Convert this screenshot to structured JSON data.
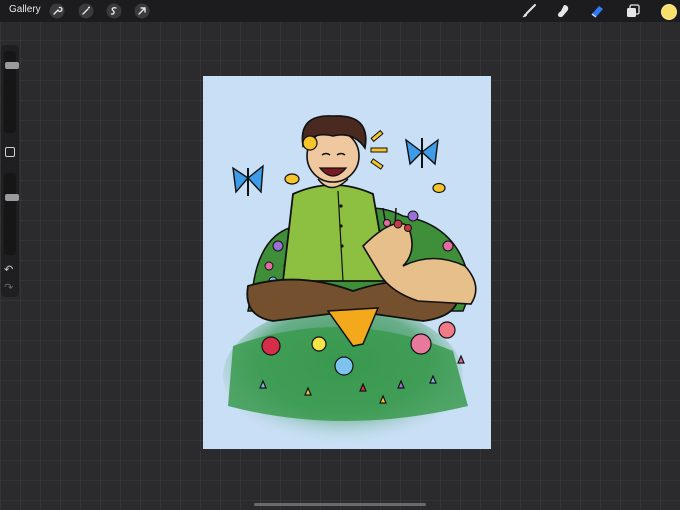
{
  "toolbar": {
    "gallery_label": "Gallery",
    "left_tools": [
      {
        "icon": "wrench-icon"
      },
      {
        "icon": "magic-wand-icon"
      },
      {
        "icon": "selection-icon"
      },
      {
        "icon": "transform-arrow-icon"
      }
    ],
    "right_tools": [
      {
        "icon": "brush-icon"
      },
      {
        "icon": "smudge-icon"
      },
      {
        "icon": "eraser-icon",
        "active": true
      },
      {
        "icon": "layers-icon"
      }
    ],
    "current_color": "#f7df6c",
    "accent": "#2f7bf5"
  },
  "sidebar": {
    "brush_size": 0.85,
    "brush_opacity": 0.72,
    "undo": "↶",
    "redo": "↷"
  },
  "canvas": {
    "background": "#c9dff5"
  }
}
